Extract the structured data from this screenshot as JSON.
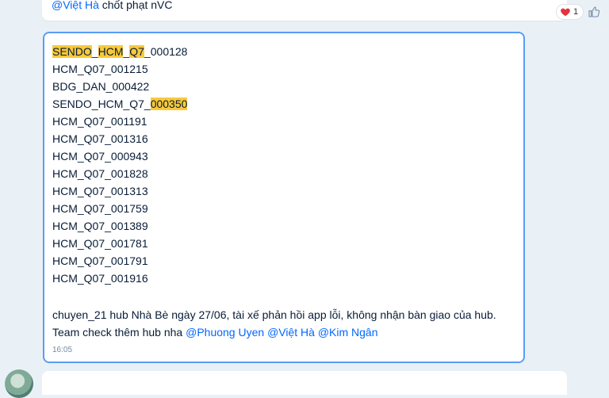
{
  "prev_message": {
    "mention": "@Việt Hà",
    "text": " chốt phạt nVC",
    "reaction_count": "1"
  },
  "message": {
    "codes": [
      {
        "parts": [
          {
            "t": "SENDO",
            "h": true
          },
          {
            "t": "_",
            "h": false
          },
          {
            "t": "HCM",
            "h": true
          },
          {
            "t": "_",
            "h": false
          },
          {
            "t": "Q7",
            "h": true
          },
          {
            "t": "_000128",
            "h": false
          }
        ]
      },
      {
        "parts": [
          {
            "t": "HCM_Q07_001215",
            "h": false
          }
        ]
      },
      {
        "parts": [
          {
            "t": "BDG_DAN_000422",
            "h": false
          }
        ]
      },
      {
        "parts": [
          {
            "t": "SENDO_HCM_Q7_",
            "h": false
          },
          {
            "t": "000350",
            "h": true
          }
        ]
      },
      {
        "parts": [
          {
            "t": "HCM_Q07_001191",
            "h": false
          }
        ]
      },
      {
        "parts": [
          {
            "t": "HCM_Q07_001316",
            "h": false
          }
        ]
      },
      {
        "parts": [
          {
            "t": "HCM_Q07_000943",
            "h": false
          }
        ]
      },
      {
        "parts": [
          {
            "t": "HCM_Q07_001828",
            "h": false
          }
        ]
      },
      {
        "parts": [
          {
            "t": "HCM_Q07_001313",
            "h": false
          }
        ]
      },
      {
        "parts": [
          {
            "t": "HCM_Q07_001759",
            "h": false
          }
        ]
      },
      {
        "parts": [
          {
            "t": "HCM_Q07_001389",
            "h": false
          }
        ]
      },
      {
        "parts": [
          {
            "t": "HCM_Q07_001781",
            "h": false
          }
        ]
      },
      {
        "parts": [
          {
            "t": "HCM_Q07_001791",
            "h": false
          }
        ]
      },
      {
        "parts": [
          {
            "t": "HCM_Q07_001916",
            "h": false
          }
        ]
      }
    ],
    "note_line1": "chuyen_21 hub Nhà Bè ngày 27/06, tài xế phản hồi app lỗi, không nhận bàn giao của hub.",
    "note_line2_prefix": "Team check thêm hub nha ",
    "mentions": [
      "@Phuong Uyen",
      "@Việt Hà",
      "@Kim Ngân"
    ],
    "time": "16:05"
  },
  "colors": {
    "highlight": "#f8c93a",
    "mention": "#0068ff",
    "selected_border": "#5a9cf6",
    "background": "#e9f1f7"
  }
}
